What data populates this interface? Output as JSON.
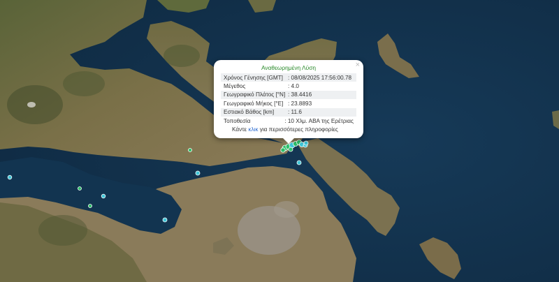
{
  "popup": {
    "title": "Αναθεωρημένη Λύση",
    "close_symbol": "×",
    "rows": [
      {
        "label": "Χρόνος Γένησης [GMT]",
        "value": ": 08/08/2025 17:56:00.78"
      },
      {
        "label": "Μέγεθος",
        "value": ": 4.0"
      },
      {
        "label": "Γεωγραφικό Πλάτος [°N]",
        "value": ": 38.4416"
      },
      {
        "label": "Γεωγραφικό Μήκος [°E]",
        "value": ": 23.8893"
      },
      {
        "label": "Εστιακό Βάθος [km]",
        "value": ": 11.6"
      },
      {
        "label": "Τοποθεσία",
        "value": ": 10 Χλμ. ΑΒΑ της Ερέτριας"
      }
    ],
    "footer_pre": "Κάντε",
    "footer_link": "κλικ",
    "footer_post": "για περισσότερες πληροφορίες"
  },
  "colors": {
    "sea": "#12304a",
    "land": "#6b6a45",
    "marker_green": "#2ebf6a",
    "marker_cyan": "#3fc6d8",
    "title_green": "#2a8a2a",
    "link": "#2a6ad0"
  }
}
